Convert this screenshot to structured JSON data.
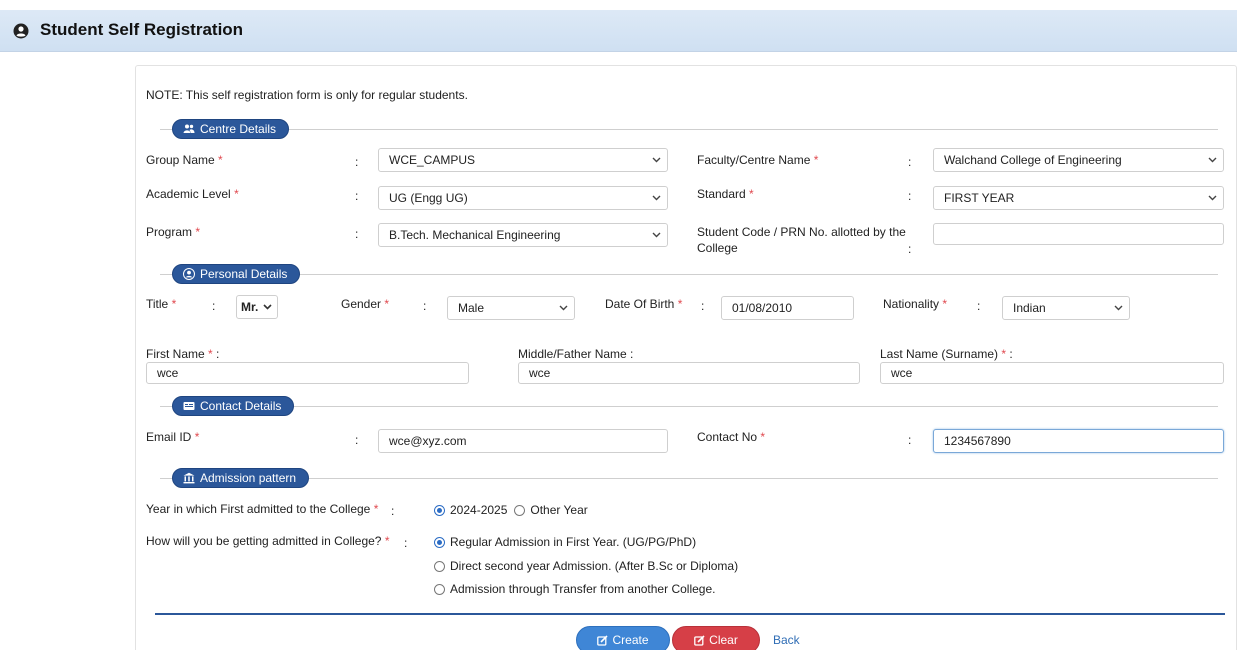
{
  "header": {
    "title": "Student Self Registration"
  },
  "note": "NOTE: This self registration form is only for regular students.",
  "sections": {
    "centre": "Centre Details",
    "personal": "Personal Details",
    "contact": "Contact Details",
    "admission": "Admission pattern"
  },
  "required_mark": "*",
  "colon": ":",
  "centre": {
    "group_name_label": "Group Name",
    "group_name_value": "WCE_CAMPUS",
    "faculty_label": "Faculty/Centre Name",
    "faculty_value": "Walchand College of Engineering",
    "academic_level_label": "Academic Level",
    "academic_level_value": "UG (Engg UG)",
    "standard_label": "Standard",
    "standard_value": "FIRST YEAR",
    "program_label": "Program",
    "program_value": "B.Tech. Mechanical Engineering",
    "student_code_label_1": "Student Code / PRN No. allotted by the",
    "student_code_label_2": "College",
    "student_code_value": ""
  },
  "personal": {
    "title_label": "Title",
    "title_value": "Mr.",
    "gender_label": "Gender",
    "gender_value": "Male",
    "dob_label": "Date Of Birth",
    "dob_value": "01/08/2010",
    "nationality_label": "Nationality",
    "nationality_value": "Indian",
    "first_name_label": "First Name",
    "first_name_value": "wce",
    "middle_name_label": "Middle/Father Name :",
    "middle_name_value": "wce",
    "last_name_label": "Last Name (Surname)",
    "last_name_value": "wce"
  },
  "contact": {
    "email_label": "Email ID",
    "email_value": "wce@xyz.com",
    "contact_label": "Contact No",
    "contact_value": "1234567890"
  },
  "admission": {
    "year_label": "Year in which First admitted to the College",
    "year_options": [
      "2024-2025",
      "Other Year"
    ],
    "how_label": "How will you be getting admitted in College?",
    "how_options": [
      "Regular Admission in First Year. (UG/PG/PhD)",
      "Direct second year Admission. (After B.Sc or Diploma)",
      "Admission through Transfer from another College."
    ]
  },
  "buttons": {
    "create": "Create",
    "clear": "Clear",
    "back": "Back"
  },
  "colors": {
    "accent": "#2b579a",
    "create": "#3f86d6",
    "clear": "#d63f47",
    "required": "#e0484e"
  }
}
